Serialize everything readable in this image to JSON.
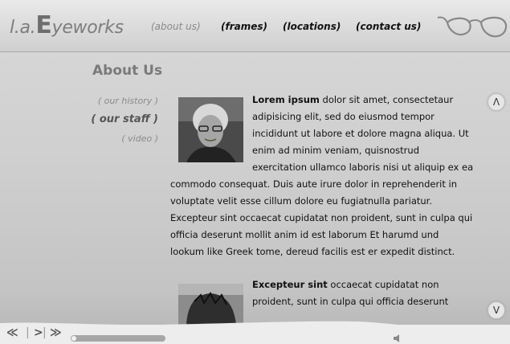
{
  "header": {
    "logo_prefix": "l.a.",
    "logo_big": "E",
    "logo_suffix": "yeworks",
    "nav": [
      {
        "label": "(about us)"
      },
      {
        "label": "(frames)"
      },
      {
        "label": "(locations)"
      },
      {
        "label": "(contact us)"
      }
    ]
  },
  "page": {
    "title": "About Us",
    "subnav": [
      {
        "label": "( our history )"
      },
      {
        "label": "( our staff )"
      },
      {
        "label": "( video )"
      }
    ]
  },
  "content": {
    "para1_lines": [
      {
        "bold": "Lorem ipsum",
        "rest": " dolor sit amet, consectetaur"
      },
      {
        "bold": "",
        "rest": "adipisicing elit, sed do eiusmod tempor"
      },
      {
        "bold": "",
        "rest": "incididunt ut labore et dolore magna aliqua. Ut"
      },
      {
        "bold": "",
        "rest": "enim ad minim veniam, quisnostrud"
      },
      {
        "bold": "",
        "rest": "exercitation ullamco laboris nisi ut aliquip ex ea"
      },
      {
        "bold": "",
        "rest": "commodo consequat. Duis aute irure dolor in reprehenderit in"
      },
      {
        "bold": "",
        "rest": "voluptate velit esse cillum dolore eu fugiatnulla pariatur."
      },
      {
        "bold": "",
        "rest": "Excepteur sint occaecat cupidatat non proident, sunt in culpa qui"
      },
      {
        "bold": "",
        "rest": "officia deserunt mollit anim id est laborum Et harumd und"
      },
      {
        "bold": "",
        "rest": "lookum like Greek tome, dereud facilis est er expedit distinct."
      }
    ],
    "para2_lines": [
      {
        "bold": "Excepteur sint",
        "rest": " occaecat cupidatat non"
      },
      {
        "bold": "",
        "rest": "proident, sunt in culpa qui officia deserunt"
      }
    ]
  },
  "controls": {
    "scroll_up": "Λ",
    "scroll_down": "V",
    "rewind": "≪",
    "play": ">",
    "forward": "≫",
    "playback_progress": 0.0
  },
  "colors": {
    "background": "#cfcfcf",
    "nav_active": "#111111",
    "nav_inactive": "#8a8a8a"
  }
}
